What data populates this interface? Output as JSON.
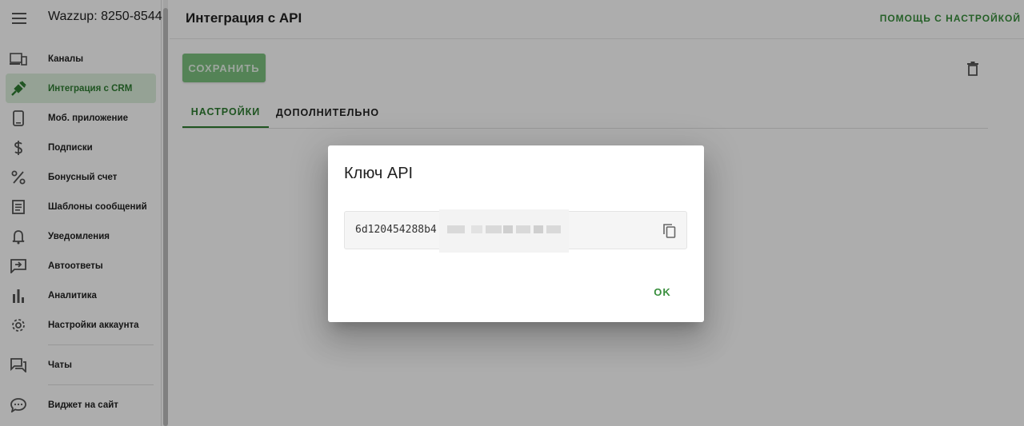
{
  "app": {
    "title": "Wazzup: 8250-8544",
    "page_title": "Интеграция с API",
    "help_link": "ПОМОЩЬ С НАСТРОЙКОЙ"
  },
  "sidebar": {
    "items": [
      {
        "label": "Каналы",
        "icon": "devices-icon"
      },
      {
        "label": "Интеграция с CRM",
        "icon": "plug-icon",
        "active": true
      },
      {
        "label": "Моб. приложение",
        "icon": "smartphone-icon"
      },
      {
        "label": "Подписки",
        "icon": "dollar-icon"
      },
      {
        "label": "Бонусный счет",
        "icon": "percent-icon"
      },
      {
        "label": "Шаблоны сообщений",
        "icon": "document-icon"
      },
      {
        "label": "Уведомления",
        "icon": "bell-icon"
      },
      {
        "label": "Автоответы",
        "icon": "auto-reply-icon"
      },
      {
        "label": "Аналитика",
        "icon": "bar-chart-icon"
      },
      {
        "label": "Настройки аккаунта",
        "icon": "gear-icon"
      },
      {
        "label": "Чаты",
        "icon": "chat-icon"
      },
      {
        "label": "Виджет на сайт",
        "icon": "chat-bubble-icon"
      }
    ]
  },
  "toolbar": {
    "save_label": "СОХРАНИТЬ"
  },
  "tabs": [
    {
      "label": "НАСТРОЙКИ",
      "active": true
    },
    {
      "label": "ДОПОЛНИТЕЛЬНО",
      "active": false
    }
  ],
  "dialog": {
    "title": "Ключ API",
    "key_value": "6d120454288b4",
    "ok_label": "OK"
  },
  "colors": {
    "accent": "#388e3c",
    "save_button": "#7cc17f",
    "active_nav_bg": "#dcefdc"
  }
}
